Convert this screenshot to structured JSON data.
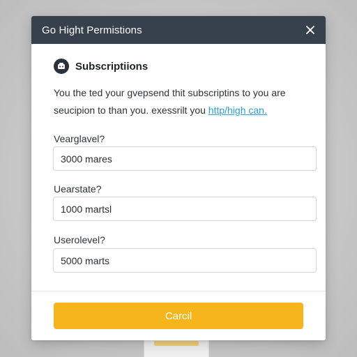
{
  "modal": {
    "title": "Go Hight Permistions",
    "close_icon": "close-icon"
  },
  "section": {
    "icon": "subscriptions-icon",
    "title": "Subscriptiions"
  },
  "description": {
    "line1": "You the ted your gvepsend thit subscriptins to you are",
    "line2_prefix": "seucipion to than you. exessrilt you ",
    "link_text": "http/high can."
  },
  "fields": [
    {
      "label": "Vearglavel?",
      "value": "3000 mares"
    },
    {
      "label": "Uearstate?",
      "value": "1000 martsl"
    },
    {
      "label": "Userolevel?",
      "value": "5000 marts"
    }
  ],
  "footer": {
    "cancel_label": "Carcil"
  },
  "colors": {
    "header_bg": "#37414d",
    "accent": "#f7b51c",
    "link": "#2a9fd6"
  }
}
